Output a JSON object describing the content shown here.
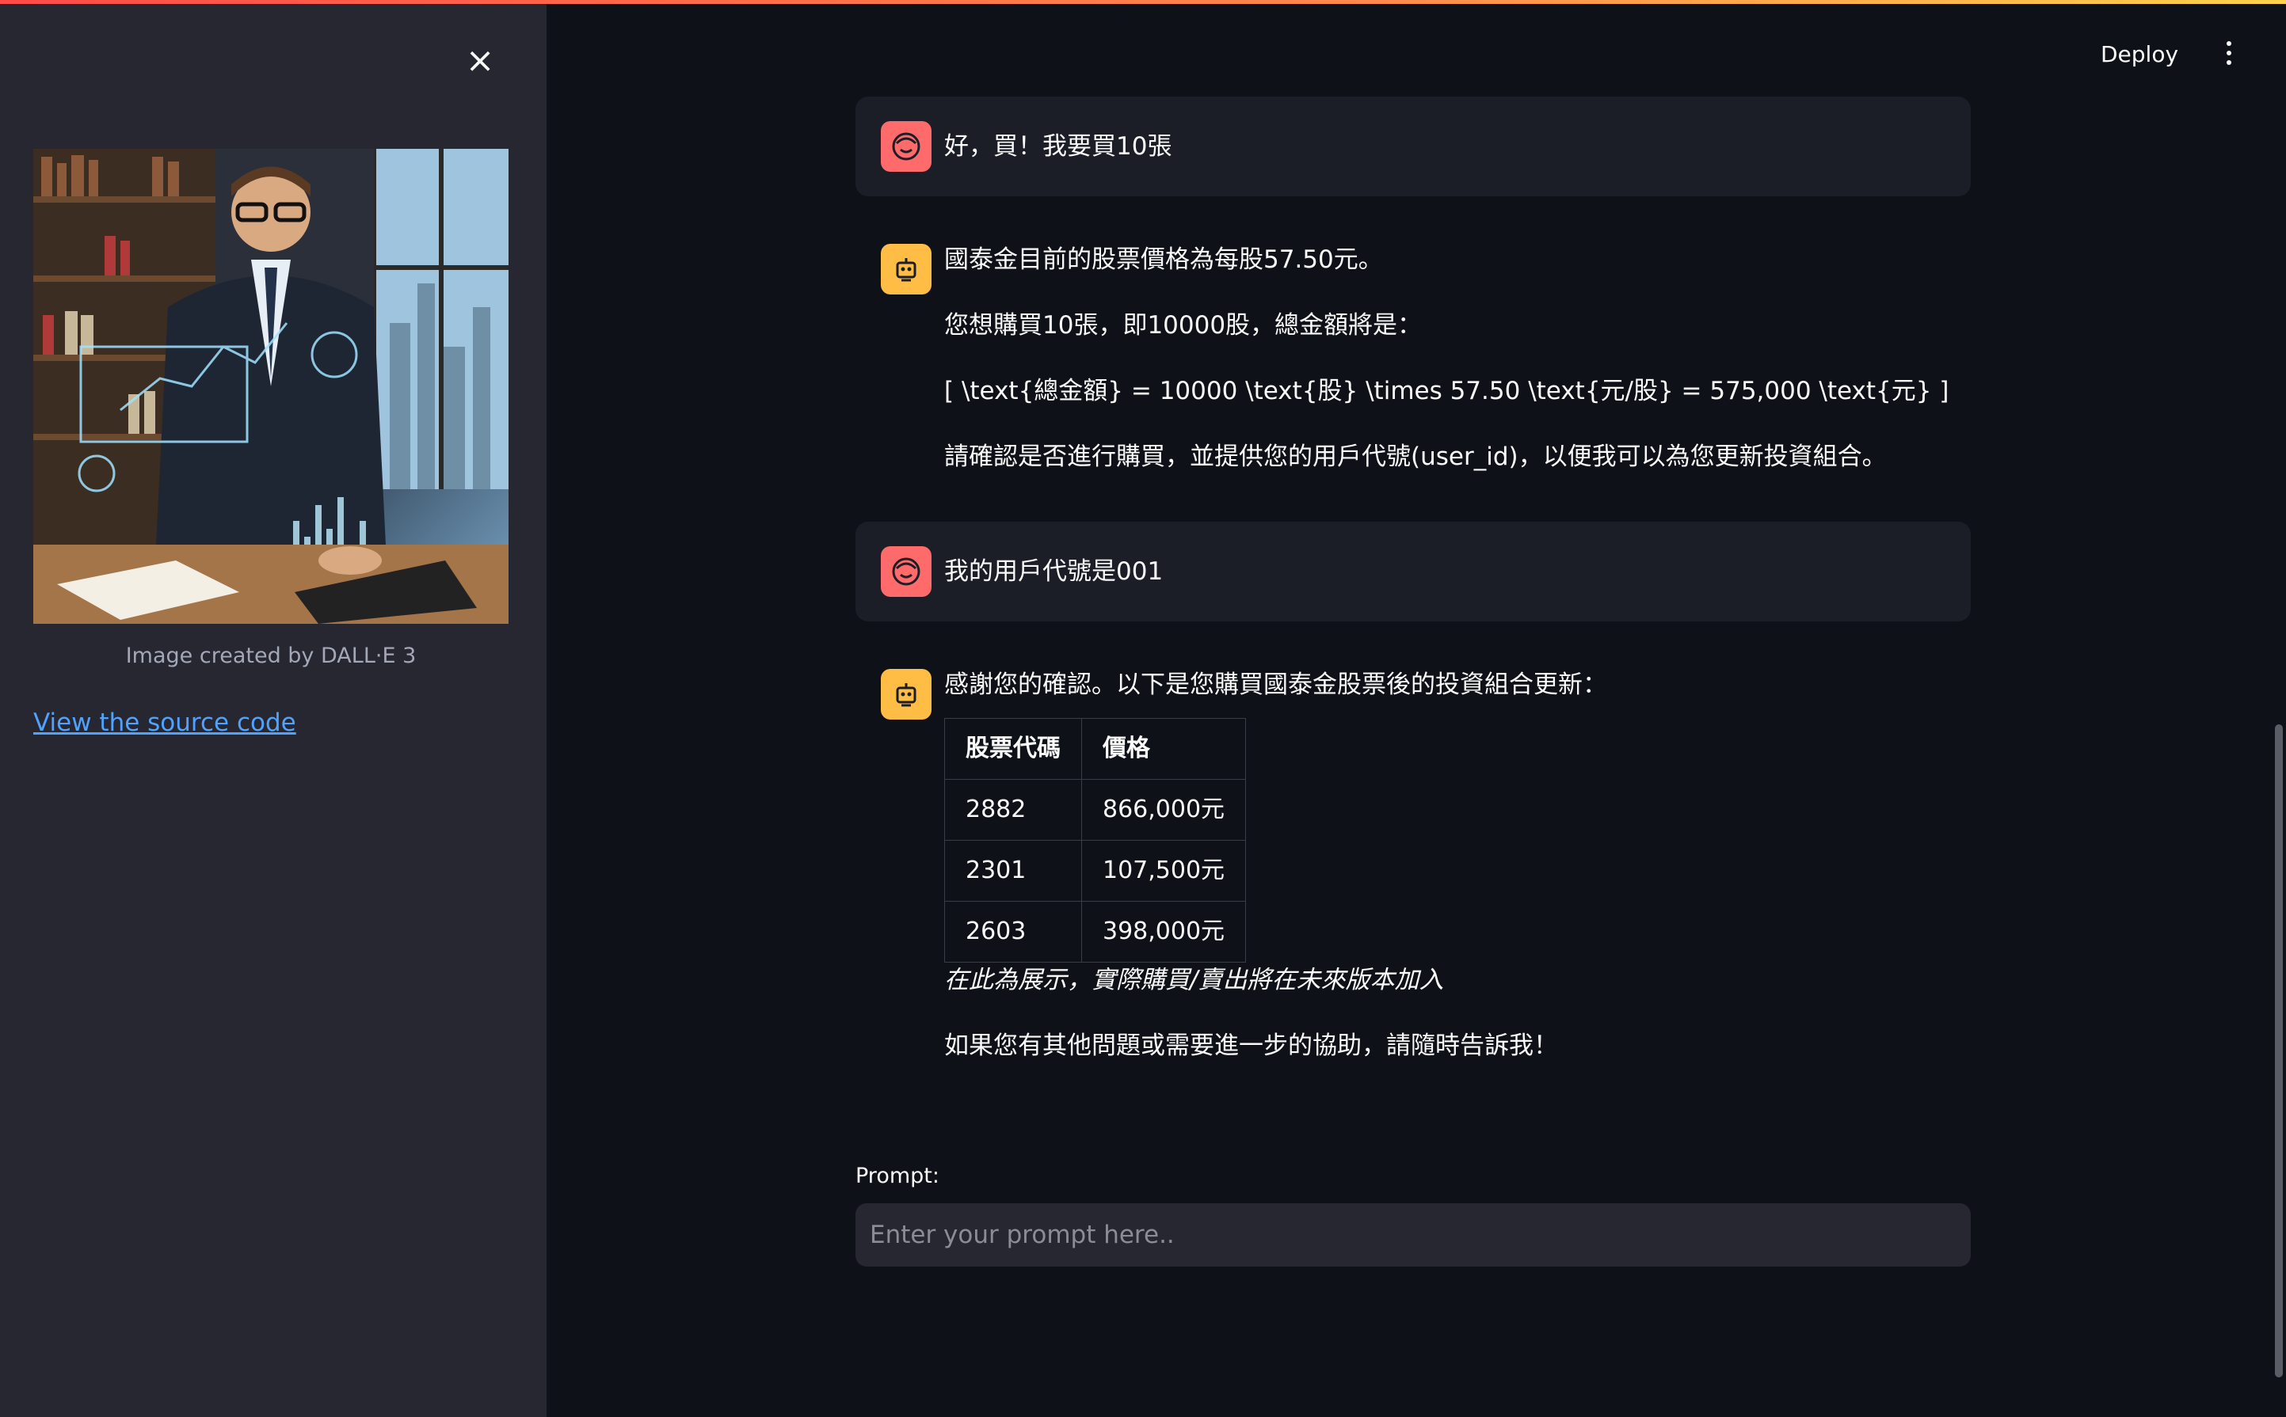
{
  "app": {
    "deploy_label": "Deploy",
    "accent_gradient": [
      "#ff4b4b",
      "#ffd24b"
    ]
  },
  "sidebar": {
    "close_icon": "close-icon",
    "image_caption": "Image created by DALL·E 3",
    "source_link": "View the source code"
  },
  "chat": {
    "messages": [
      {
        "role": "user",
        "avatar_icon": "smiley-face-icon",
        "text": "好，買！我要買10張"
      },
      {
        "role": "assistant",
        "avatar_icon": "robot-icon",
        "paragraphs": [
          "國泰金目前的股票價格為每股57.50元。",
          "您想購買10張，即10000股，總金額將是：",
          "[ \\text{總金額} = 10000 \\text{股} \\times 57.50 \\text{元/股} = 575,000 \\text{元} ]",
          "請確認是否進行購買，並提供您的用戶代號(user_id)，以便我可以為您更新投資組合。"
        ]
      },
      {
        "role": "user",
        "avatar_icon": "smiley-face-icon",
        "text": "我的用戶代號是001"
      },
      {
        "role": "assistant",
        "avatar_icon": "robot-icon",
        "intro": "感謝您的確認。以下是您購買國泰金股票後的投資組合更新：",
        "table": {
          "headers": [
            "股票代碼",
            "價格"
          ],
          "rows": [
            [
              "2882",
              "866,000元"
            ],
            [
              "2301",
              "107,500元"
            ],
            [
              "2603",
              "398,000元"
            ]
          ]
        },
        "note": "在此為展示，實際購買/賣出將在未來版本加入",
        "closing": "如果您有其他問題或需要進一步的協助，請隨時告訴我！"
      }
    ]
  },
  "prompt": {
    "label": "Prompt:",
    "placeholder": "Enter your prompt here.."
  },
  "colors": {
    "main_bg": "#0e1117",
    "sidebar_bg": "#262730",
    "user_avatar": "#ff6b6b",
    "bot_avatar": "#ffbd45",
    "link": "#4fa3ff"
  }
}
